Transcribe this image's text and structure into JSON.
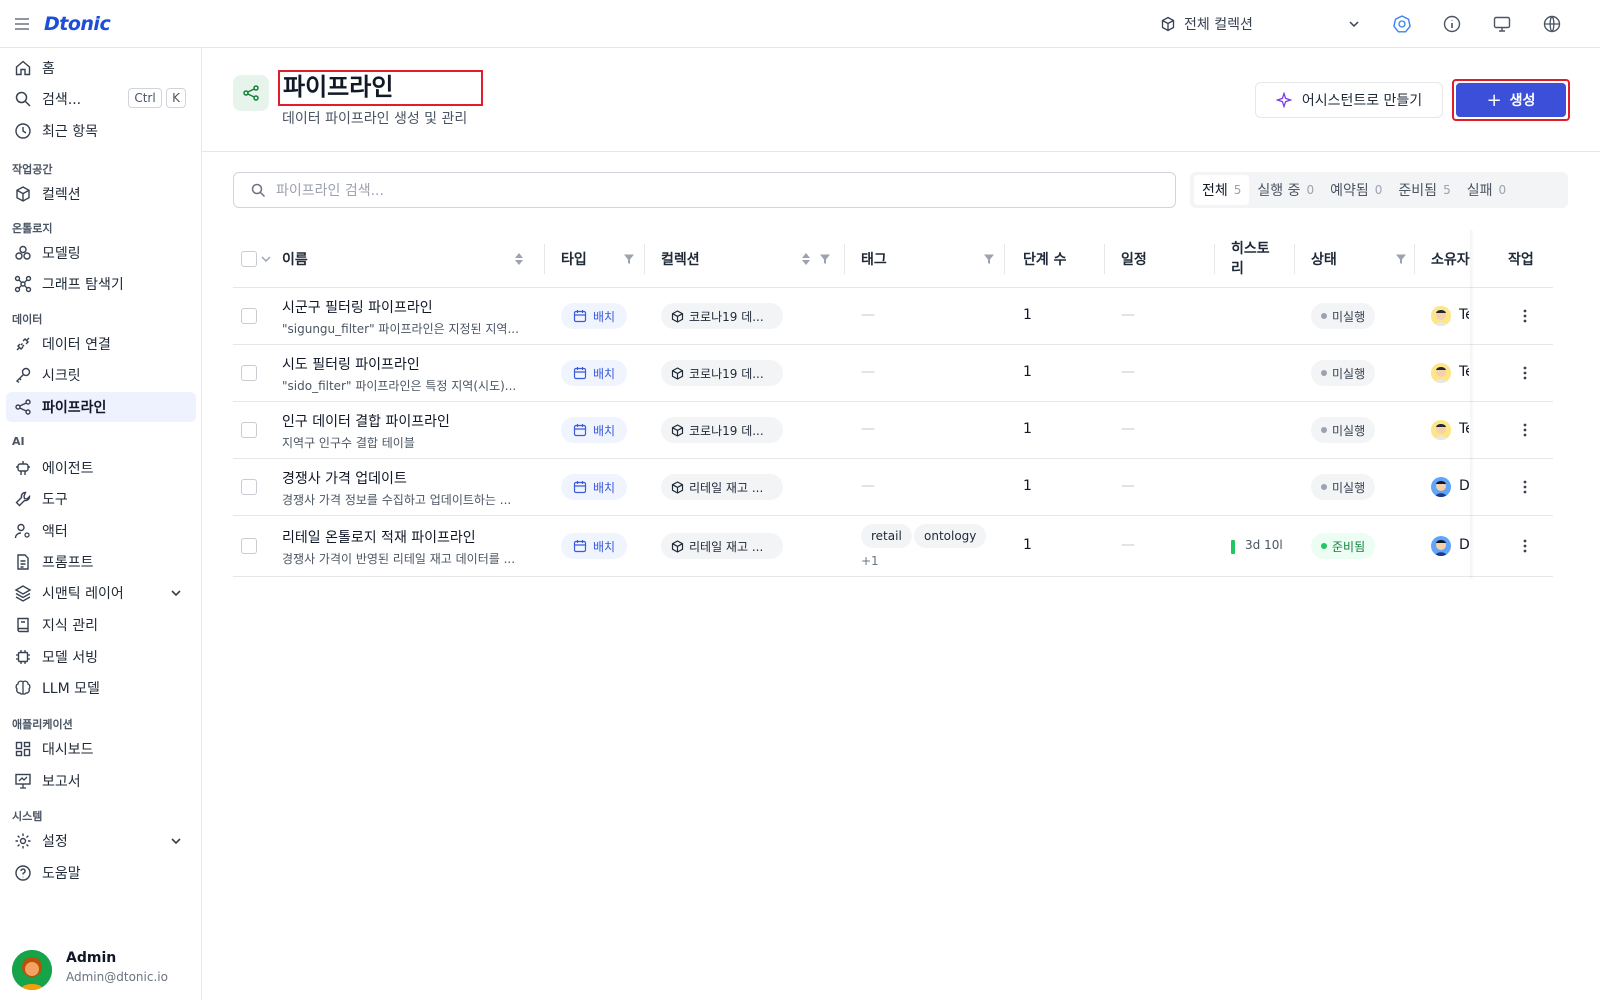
{
  "app": {
    "logo": "Dtonic"
  },
  "topbar": {
    "collection_select": "전체 컬렉션"
  },
  "sidebar": {
    "home": "홈",
    "search": "검색...",
    "kbd_ctrl": "Ctrl",
    "kbd_k": "K",
    "recent": "최근 항목",
    "sections": {
      "workspace": "작업공간",
      "ontology": "온톨로지",
      "data": "데이터",
      "ai": "AI",
      "applications": "애플리케이션",
      "system": "시스템"
    },
    "collections": "컬렉션",
    "modeling": "모델링",
    "graph_explorer": "그래프 탐색기",
    "data_connection": "데이터 연결",
    "secrets": "시크릿",
    "pipeline": "파이프라인",
    "agents": "에이전트",
    "tools": "도구",
    "actors": "액터",
    "prompts": "프롬프트",
    "semantic_layer": "시맨틱 레이어",
    "knowledge": "지식 관리",
    "model_serving": "모델 서빙",
    "llm_models": "LLM 모델",
    "dashboard": "대시보드",
    "reports": "보고서",
    "settings": "설정",
    "help": "도움말",
    "user": {
      "name": "Admin",
      "email": "Admin@dtonic.io"
    }
  },
  "header": {
    "title": "파이프라인",
    "subtitle": "데이터 파이프라인 생성 및 관리",
    "assistant_button": "어시스턴트로 만들기",
    "create_button": "생성"
  },
  "search": {
    "placeholder": "파이프라인 검색..."
  },
  "filters": [
    {
      "label": "전체",
      "count": "5"
    },
    {
      "label": "실행 중",
      "count": "0"
    },
    {
      "label": "예약됨",
      "count": "0"
    },
    {
      "label": "준비됨",
      "count": "5"
    },
    {
      "label": "실패",
      "count": "0"
    }
  ],
  "table": {
    "columns": {
      "name": "이름",
      "type": "타입",
      "collection": "컬렉션",
      "tags": "태그",
      "steps": "단계 수",
      "schedule": "일정",
      "history": "히스토리",
      "status": "상태",
      "owner": "소유자",
      "actions": "작업"
    },
    "rows": [
      {
        "name": "시군구 필터링 파이프라인",
        "desc": "\"sigungu_filter\" 파이프라인은 지정된 지역...",
        "type": "배치",
        "collection": "코로나19 데...",
        "tags": "—",
        "steps": "1",
        "schedule": "—",
        "status": "미실행",
        "owner": "Te"
      },
      {
        "name": "시도 필터링 파이프라인",
        "desc": "\"sido_filter\" 파이프라인은 특정 지역(시도)...",
        "type": "배치",
        "collection": "코로나19 데...",
        "tags": "—",
        "steps": "1",
        "schedule": "—",
        "status": "미실행",
        "owner": "Te"
      },
      {
        "name": "인구 데이터 결합 파이프라인",
        "desc": "지역구 인구수 결합 테이블",
        "type": "배치",
        "collection": "코로나19 데...",
        "tags": "—",
        "steps": "1",
        "schedule": "—",
        "status": "미실행",
        "owner": "Te"
      },
      {
        "name": "경쟁사 가격 업데이트",
        "desc": "경쟁사 가격 정보를 수집하고 업데이트하는 ...",
        "type": "배치",
        "collection": "리테일 재고 ...",
        "tags": "—",
        "steps": "1",
        "schedule": "—",
        "status": "미실행",
        "owner": "D"
      },
      {
        "name": "리테일 온톨로지 적재 파이프라인",
        "desc": "경쟁사 가격이 반영된 리테일 재고 데이터를 ...",
        "type": "배치",
        "collection": "리테일 재고 ...",
        "tag1": "retail",
        "tag2": "ontology",
        "tag_more": "+1",
        "steps": "1",
        "schedule": "—",
        "history": "3d 10l",
        "status": "준비됨",
        "owner": "D"
      }
    ]
  },
  "colors": {
    "accent": "#3b4fd8",
    "highlight": "#e11d2a",
    "ready": "#22c55e"
  }
}
